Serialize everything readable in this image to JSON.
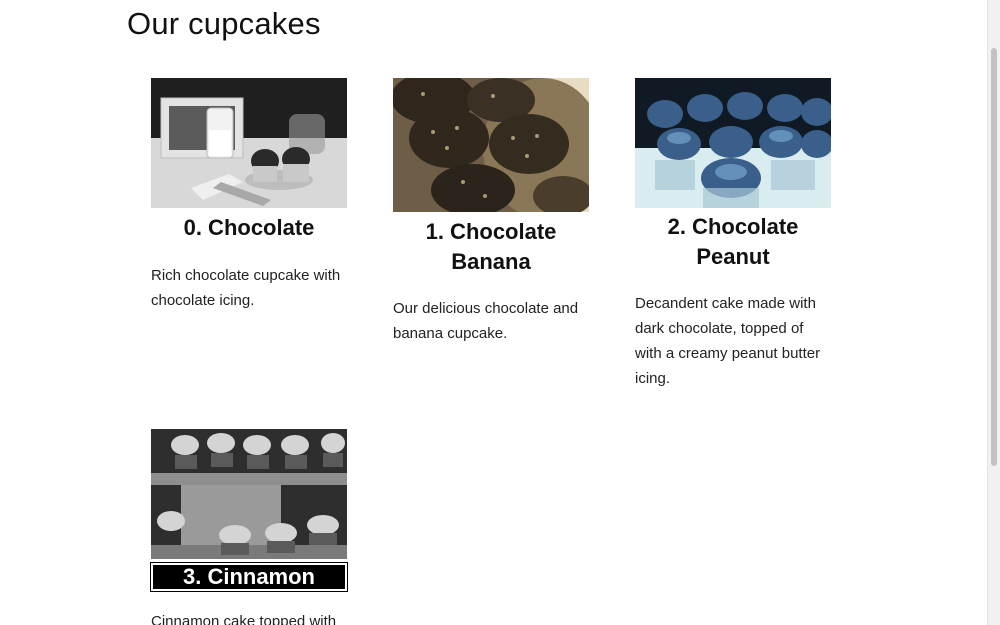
{
  "page": {
    "title": "Our cupcakes"
  },
  "cupcakes": [
    {
      "title": "0. Chocolate",
      "description": "Rich chocolate cupcake with chocolate icing.",
      "image_filter": "grayscale"
    },
    {
      "title": "1. Chocolate Banana",
      "description": "Our delicious chocolate and banana cupcake.",
      "image_filter": "sepia"
    },
    {
      "title": "2. Chocolate Peanut",
      "description": "Decandent cake made with dark chocolate, topped of with a creamy peanut butter icing.",
      "image_filter": "inverted"
    },
    {
      "title": "3. Cinnamon",
      "description": "Cinnamon cake topped with",
      "image_filter": "grayscale"
    }
  ],
  "colors": {
    "background": "#ffffff",
    "text": "#111111",
    "scrollbar_track": "#f1f1f1",
    "scrollbar_thumb": "#c2c2c2"
  }
}
